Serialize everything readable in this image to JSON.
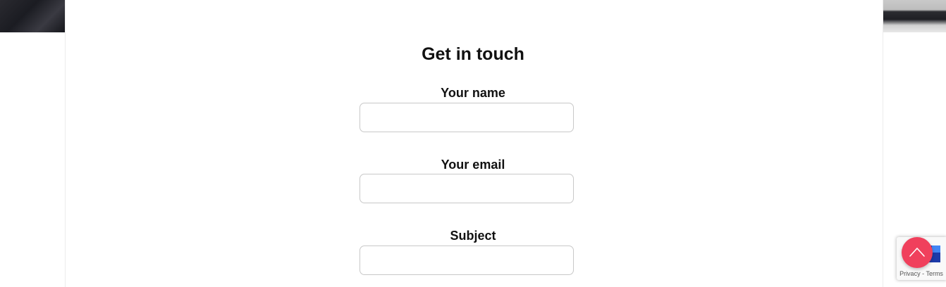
{
  "contact_form": {
    "title": "Get in touch",
    "fields": [
      {
        "label": "Your name",
        "value": "",
        "placeholder": ""
      },
      {
        "label": "Your email",
        "value": "",
        "placeholder": ""
      },
      {
        "label": "Subject",
        "value": "",
        "placeholder": ""
      }
    ]
  },
  "recaptcha": {
    "privacy_label": "Privacy",
    "separator": "-",
    "terms_label": "Terms"
  },
  "icons": {
    "scroll_top": "chevron-up-icon",
    "recaptcha": "recaptcha-logo-icon"
  },
  "colors": {
    "scroll_top_button": "#f0405c",
    "heading_text": "#111111",
    "input_border": "#c8c8c8"
  }
}
